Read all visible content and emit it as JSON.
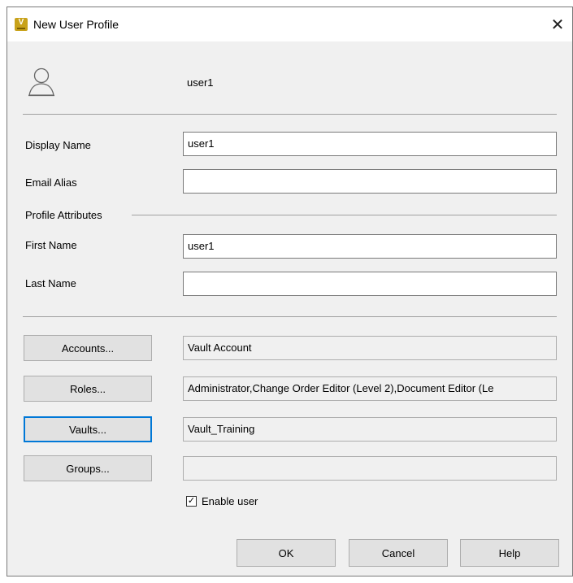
{
  "window": {
    "title": "New User Profile",
    "app_icon_letter": "V",
    "close_glyph": "✕"
  },
  "header": {
    "username": "user1",
    "avatar_icon": "user-silhouette-icon"
  },
  "fields": {
    "display_name": {
      "label": "Display Name",
      "value": "user1"
    },
    "email_alias": {
      "label": "Email Alias",
      "value": ""
    },
    "profile_attributes_label": "Profile Attributes",
    "first_name": {
      "label": "First Name",
      "value": "user1"
    },
    "last_name": {
      "label": "Last Name",
      "value": ""
    }
  },
  "assignments": {
    "accounts": {
      "button": "Accounts...",
      "value": "Vault Account"
    },
    "roles": {
      "button": "Roles...",
      "value": "Administrator,Change Order Editor (Level 2),Document Editor (Le"
    },
    "vaults": {
      "button": "Vaults...",
      "value": "Vault_Training"
    },
    "groups": {
      "button": "Groups...",
      "value": ""
    }
  },
  "enable_user": {
    "label": "Enable user",
    "checked": true,
    "check_glyph": "✓"
  },
  "footer": {
    "ok": "OK",
    "cancel": "Cancel",
    "help": "Help"
  },
  "colors": {
    "accent_focus": "#0078d7",
    "app_icon": "#c8a21a",
    "dialog_bg": "#f0f0f0"
  }
}
